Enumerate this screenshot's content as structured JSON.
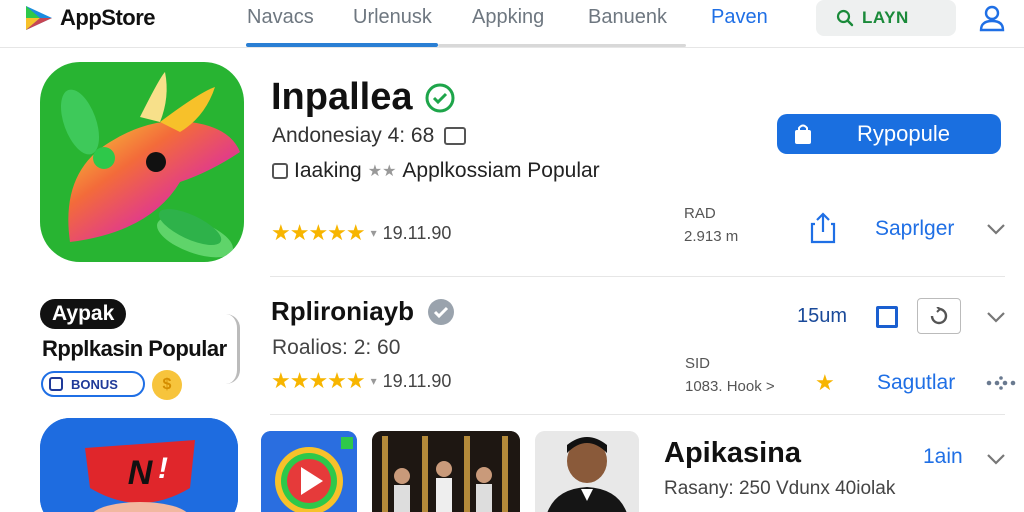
{
  "header": {
    "logo_text": "AppStore",
    "tabs": [
      {
        "label": "Navacs"
      },
      {
        "label": "Urlenusk"
      },
      {
        "label": "Appking"
      },
      {
        "label": "Banuenk"
      },
      {
        "label": "Paven"
      }
    ],
    "search_text": "LAYN"
  },
  "featured": {
    "title": "Inpallea",
    "subtitle": "Andonesiay 4: 68",
    "tagline_prefix": "Iaaking",
    "tagline": "Applkossiam Popular",
    "get_label": "Rypopule",
    "rating_text": "19.11.90",
    "meta_line1": "RAD",
    "meta_line2": "2.913 m",
    "share_label": "Saprlger"
  },
  "item2": {
    "badge": "Aypak",
    "category_label": "Rpplkasin Popular",
    "bonus_label": "BONUS",
    "title": "Rplironiayb",
    "subtitle": "Roalios: 2: 60",
    "size": "15um",
    "rating_text": "19.11.90",
    "meta_line1": "SID",
    "meta_line2": "1083. Hook >",
    "link_label": "Sagutlar"
  },
  "item3": {
    "title": "Apikasina",
    "subtitle": "Rasany: 250  Vdunx 40iolak",
    "size": "1ain"
  },
  "colors": {
    "accent_blue": "#1a6fe0",
    "star_yellow": "#f7b500",
    "verified_green": "#1ea54a"
  }
}
